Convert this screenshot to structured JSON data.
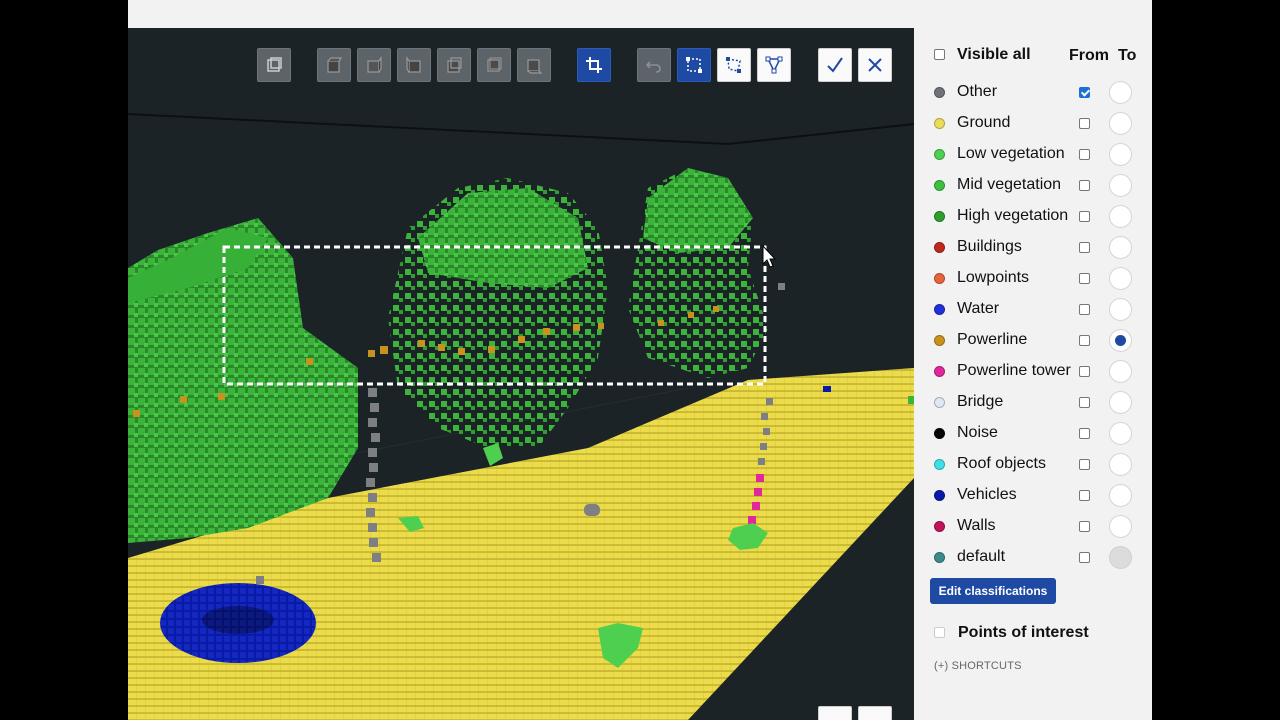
{
  "panel": {
    "visible_all_label": "Visible all",
    "from_label": "From",
    "to_label": "To",
    "edit_button": "Edit classifications",
    "poi_label": "Points of interest",
    "shortcuts_label": "(+) SHORTCUTS",
    "classes": [
      {
        "label": "Other",
        "color": "#6f7378",
        "checked": true,
        "to": "empty"
      },
      {
        "label": "Ground",
        "color": "#e8dc5a",
        "checked": false,
        "to": "empty"
      },
      {
        "label": "Low vegetation",
        "color": "#4fcf4f",
        "checked": false,
        "to": "empty"
      },
      {
        "label": "Mid vegetation",
        "color": "#3fbf3f",
        "checked": false,
        "to": "empty"
      },
      {
        "label": "High vegetation",
        "color": "#2e9e2e",
        "checked": false,
        "to": "empty"
      },
      {
        "label": "Buildings",
        "color": "#c0281c",
        "checked": false,
        "to": "empty"
      },
      {
        "label": "Lowpoints",
        "color": "#e8623a",
        "checked": false,
        "to": "empty"
      },
      {
        "label": "Water",
        "color": "#2230d8",
        "checked": false,
        "to": "empty"
      },
      {
        "label": "Powerline",
        "color": "#c8921e",
        "checked": false,
        "to": "selected"
      },
      {
        "label": "Powerline tower",
        "color": "#e0289a",
        "checked": false,
        "to": "empty"
      },
      {
        "label": "Bridge",
        "color": "#dde8f2",
        "checked": false,
        "to": "empty"
      },
      {
        "label": "Noise",
        "color": "#050505",
        "checked": false,
        "to": "empty"
      },
      {
        "label": "Roof objects",
        "color": "#3ee0e8",
        "checked": false,
        "to": "empty"
      },
      {
        "label": "Vehicles",
        "color": "#0a1aa8",
        "checked": false,
        "to": "empty"
      },
      {
        "label": "Walls",
        "color": "#c0145a",
        "checked": false,
        "to": "empty"
      },
      {
        "label": "default",
        "color": "#3a8c8a",
        "checked": false,
        "to": "disabled"
      }
    ]
  },
  "toolbar": {
    "buttons": [
      {
        "name": "view-3d-icon",
        "style": "gray"
      },
      {
        "name": "view-top-icon",
        "style": "gray"
      },
      {
        "name": "view-front-icon",
        "style": "gray"
      },
      {
        "name": "view-left-icon",
        "style": "gray"
      },
      {
        "name": "view-right-icon",
        "style": "gray"
      },
      {
        "name": "view-back-icon",
        "style": "gray"
      },
      {
        "name": "view-bottom-icon",
        "style": "gray"
      },
      {
        "name": "crop-icon",
        "style": "blue"
      },
      {
        "name": "undo-icon",
        "style": "gray"
      },
      {
        "name": "rectangle-select-icon",
        "style": "blue"
      },
      {
        "name": "lasso-select-icon",
        "style": "white"
      },
      {
        "name": "polygon-select-icon",
        "style": "white"
      },
      {
        "name": "confirm-icon",
        "style": "white"
      },
      {
        "name": "cancel-icon",
        "style": "white"
      }
    ]
  },
  "colors": {
    "accent": "#1f4aa3",
    "viewer_bg": "#1c2327"
  }
}
